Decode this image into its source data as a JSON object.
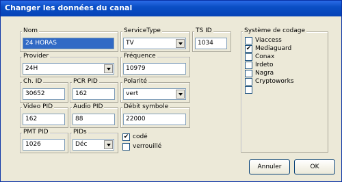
{
  "window": {
    "title": "Changer les données du canal"
  },
  "fields": {
    "nom": {
      "label": "Nom",
      "value": "24 HORAS"
    },
    "service_type": {
      "label": "ServiceType",
      "value": "TV"
    },
    "ts_id": {
      "label": "TS ID",
      "value": "1034"
    },
    "provider": {
      "label": "Provider",
      "value": "24H"
    },
    "frequence": {
      "label": "Fréquence",
      "value": "10979"
    },
    "ch_id": {
      "label": "Ch. ID",
      "value": "30652"
    },
    "pcr_pid": {
      "label": "PCR PID",
      "value": "162"
    },
    "polarite": {
      "label": "Polarité",
      "value": "vert"
    },
    "video_pid": {
      "label": "Video PID",
      "value": "162"
    },
    "audio_pid": {
      "label": "Audio PID",
      "value": "88"
    },
    "debit_symbole": {
      "label": "Débit symbole",
      "value": "22000"
    },
    "pmt_pid": {
      "label": "PMT PID",
      "value": "1026"
    },
    "pids": {
      "label": "PIDs",
      "value": "Déc"
    }
  },
  "flags": {
    "code": {
      "label": "codé",
      "checked": true,
      "mark": "✔"
    },
    "verrouille": {
      "label": "verrouillé",
      "checked": false,
      "mark": ""
    }
  },
  "codage": {
    "label": "Système de codage",
    "items": [
      {
        "label": "Viaccess",
        "mark": ""
      },
      {
        "label": "Mediaguard",
        "mark": "✔"
      },
      {
        "label": "Conax",
        "mark": ""
      },
      {
        "label": "Irdeto",
        "mark": ""
      },
      {
        "label": "Nagra",
        "mark": ""
      },
      {
        "label": "Cryptoworks",
        "mark": ""
      },
      {
        "label": "",
        "mark": ""
      }
    ]
  },
  "buttons": {
    "cancel": "Annuler",
    "ok": "OK"
  }
}
